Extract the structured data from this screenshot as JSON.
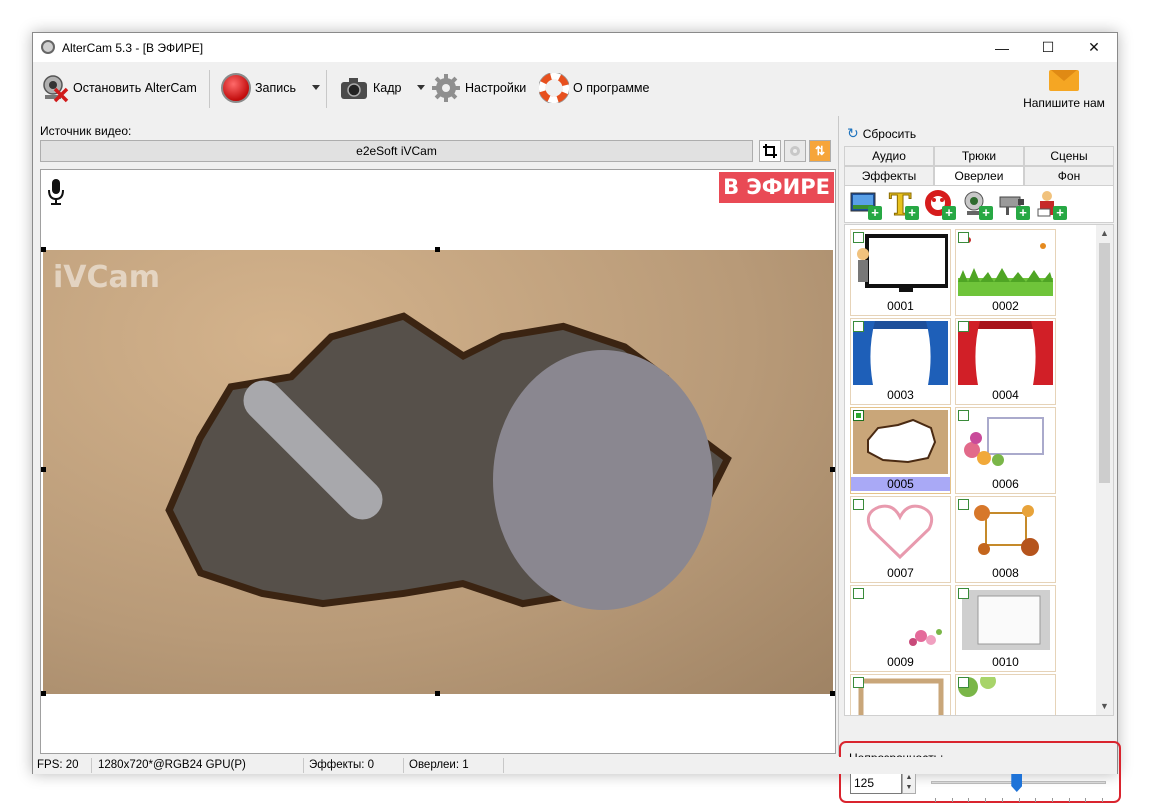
{
  "window": {
    "title": "AlterCam 5.3 - [В ЭФИРЕ]"
  },
  "window_controls": {
    "minimize": "—",
    "maximize": "☐",
    "close": "✕"
  },
  "toolbar": {
    "stop_label": "Остановить AlterCam",
    "record_label": "Запись",
    "frame_label": "Кадр",
    "settings_label": "Настройки",
    "about_label": "О программе",
    "mail_label": "Напишите нам"
  },
  "source": {
    "label": "Источник видео:",
    "value": "e2eSoft iVCam"
  },
  "preview": {
    "live_badge": "В ЭФИРЕ",
    "watermark": "iVCam"
  },
  "status": {
    "fps": "FPS: 20",
    "format": "1280x720*@RGB24 GPU(P)",
    "effects": "Эффекты: 0",
    "overlays": "Оверлеи: 1"
  },
  "right": {
    "reset_label": "Сбросить",
    "tabs_row1": [
      "Аудио",
      "Трюки",
      "Сцены"
    ],
    "tabs_row2": [
      "Эффекты",
      "Оверлеи",
      "Фон"
    ],
    "active_tab": "Оверлеи",
    "overlay_tools": [
      "add-image-overlay-icon",
      "add-text-overlay-icon",
      "add-lifebuoy-overlay-icon",
      "add-webcam-overlay-icon",
      "add-camera-overlay-icon",
      "add-person-overlay-icon"
    ],
    "thumbnails": [
      {
        "label": "0001",
        "checked": false
      },
      {
        "label": "0002",
        "checked": false
      },
      {
        "label": "0003",
        "checked": false
      },
      {
        "label": "0004",
        "checked": false
      },
      {
        "label": "0005",
        "checked": true,
        "selected": true
      },
      {
        "label": "0006",
        "checked": false
      },
      {
        "label": "0007",
        "checked": false
      },
      {
        "label": "0008",
        "checked": false
      },
      {
        "label": "0009",
        "checked": false
      },
      {
        "label": "0010",
        "checked": false
      }
    ],
    "opacity_label": "Непрозрачность:",
    "opacity_value": "125",
    "opacity_max": 255
  },
  "colors": {
    "live_red": "#e94a55",
    "accent_blue": "#1e73d8",
    "highlight": "#d9242e"
  }
}
